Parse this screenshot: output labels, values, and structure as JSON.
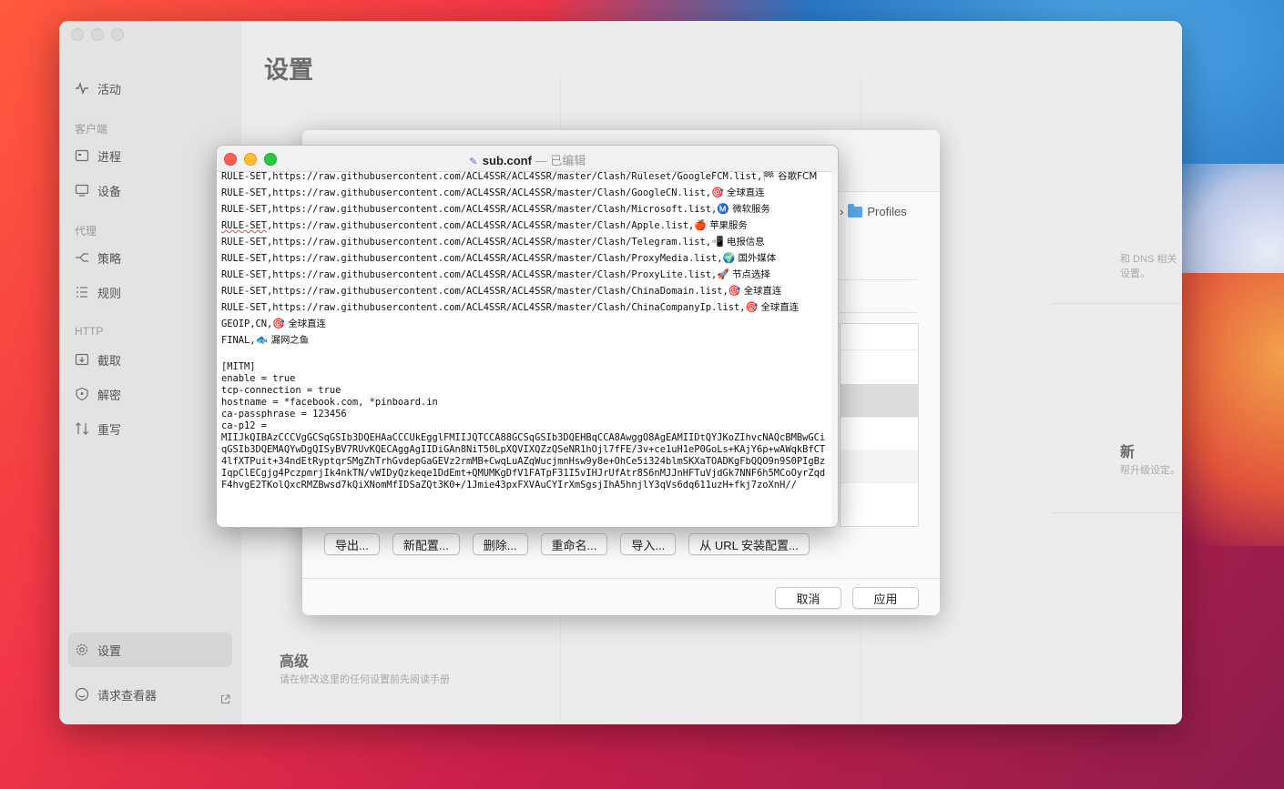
{
  "sidebar": {
    "activity": "活动",
    "section_client": "客户端",
    "process": "进程",
    "device": "设备",
    "section_proxy": "代理",
    "policy": "策略",
    "rules": "规则",
    "section_http": "HTTP",
    "capture": "截取",
    "decrypt": "解密",
    "rewrite": "重写",
    "settings": "设置",
    "request_viewer": "请求查看器"
  },
  "content": {
    "title": "设置",
    "dns_text": "和 DNS 相关设置。",
    "update_title": "新",
    "update_sub": "帮升级设定。",
    "advanced_title": "高级",
    "advanced_sub": "请在修改这里的任何设置前先阅读手册"
  },
  "profiles_sheet": {
    "breadcrumb_sep": "›",
    "breadcrumb_folder": "Profiles",
    "buttons": {
      "export": "导出...",
      "new_config": "新配置...",
      "delete": "删除...",
      "rename": "重命名...",
      "import": "导入...",
      "install_url": "从 URL 安装配置..."
    },
    "cancel": "取消",
    "apply": "应用"
  },
  "editor": {
    "file_name": "sub.conf",
    "dash": "—",
    "status": "已编辑",
    "lines": {
      "l0a": "RULE-SET,https://raw.githubusercontent.com/ACL4SSR/ACL4SSR/master/Clash/Ruleset/GoogleFCM.list,",
      "l0e": "🏁",
      "l0t": " 谷歌FCM",
      "l1a": "RULE-SET,https://raw.githubusercontent.com/ACL4SSR/ACL4SSR/master/Clash/GoogleCN.list,",
      "l1e": "🎯",
      "l1t": " 全球直连",
      "l2a": "RULE-SET,https://raw.githubusercontent.com/ACL4SSR/ACL4SSR/master/Clash/Microsoft.list,",
      "l2e": "Ⓜ️",
      "l2t": " 微软服务",
      "l3p": "RULE-SET",
      "l3a": ",https://raw.githubusercontent.com/ACL4SSR/ACL4SSR/master/Clash/Apple.list,",
      "l3e": "🍎",
      "l3t": " 苹果服务",
      "l4a": "RULE-SET,https://raw.githubusercontent.com/ACL4SSR/ACL4SSR/master/Clash/Telegram.list,",
      "l4e": "📲",
      "l4t": " 电报信息",
      "l5a": "RULE-SET,https://raw.githubusercontent.com/ACL4SSR/ACL4SSR/master/Clash/ProxyMedia.list,",
      "l5e": "🌍",
      "l5t": " 国外媒体",
      "l6a": "RULE-SET,https://raw.githubusercontent.com/ACL4SSR/ACL4SSR/master/Clash/ProxyLite.list,",
      "l6e": "🚀",
      "l6t": " 节点选择",
      "l7a": "RULE-SET,https://raw.githubusercontent.com/ACL4SSR/ACL4SSR/master/Clash/ChinaDomain.list,",
      "l7e": "🎯",
      "l7t": " 全球直连",
      "l8a": "RULE-SET,https://raw.githubusercontent.com/ACL4SSR/ACL4SSR/master/Clash/ChinaCompanyIp.list,",
      "l8e": "🎯",
      "l8t": " 全球直连",
      "l9a": "GEOIP,CN,",
      "l9e": "🎯",
      "l9t": " 全球直连",
      "l10a": "FINAL,",
      "l10e": "🐟",
      "l10t": " 漏网之鱼",
      "l11": "[MITM]",
      "l12": "enable = true",
      "l13": "tcp-connection = true",
      "l14": "hostname = *facebook.com, *pinboard.in",
      "l15": "ca-passphrase = 123456",
      "l16": "ca-p12 =",
      "cert": "MIIJkQIBAzCCCVgGCSqGSIb3DQEHAaCCCUkEgglFMIIJQTCCA88GCSqGSIb3DQEHBqCCA8AwggO8AgEAMIIDtQYJKoZIhvcNAQcBMBwGCiqGSIb3DQEMAQYwDgQISyBV7RUvKQECAggAgIIDiGAn8NiT50LpXQVIXQZzQSeNR1hOjl7fFE/3v+ce1uH1eP0GoLs+KAjY6p+wAWqkBfCT4lfXTPuit+34ndEtRyptqrSMgZhTrhGvdepGaGEVz2rmMB+CwqLuAZqWucjmnHsw9y8e+OhCe5i324blmSKXaTOADKgFbQQO9n9S0PIgBzIqpClECgjg4PczpmrjIk4nkTN/vWIDyQzkeqe1DdEmt+QMUMKgDfV1FATpF31I5vIHJrUfAtr8S6nMJJnHFTuVjdGk7NNF6h5MCoOyrZqdF4hvgE2TKolQxcRMZBwsd7kQiXNomMfIDSaZQt3K0+/1Jmie43pxFXVAuCYIrXmSgsjIhA5hnjlY3qVs6dq611uzH+fkj7zoXnH//"
    }
  }
}
